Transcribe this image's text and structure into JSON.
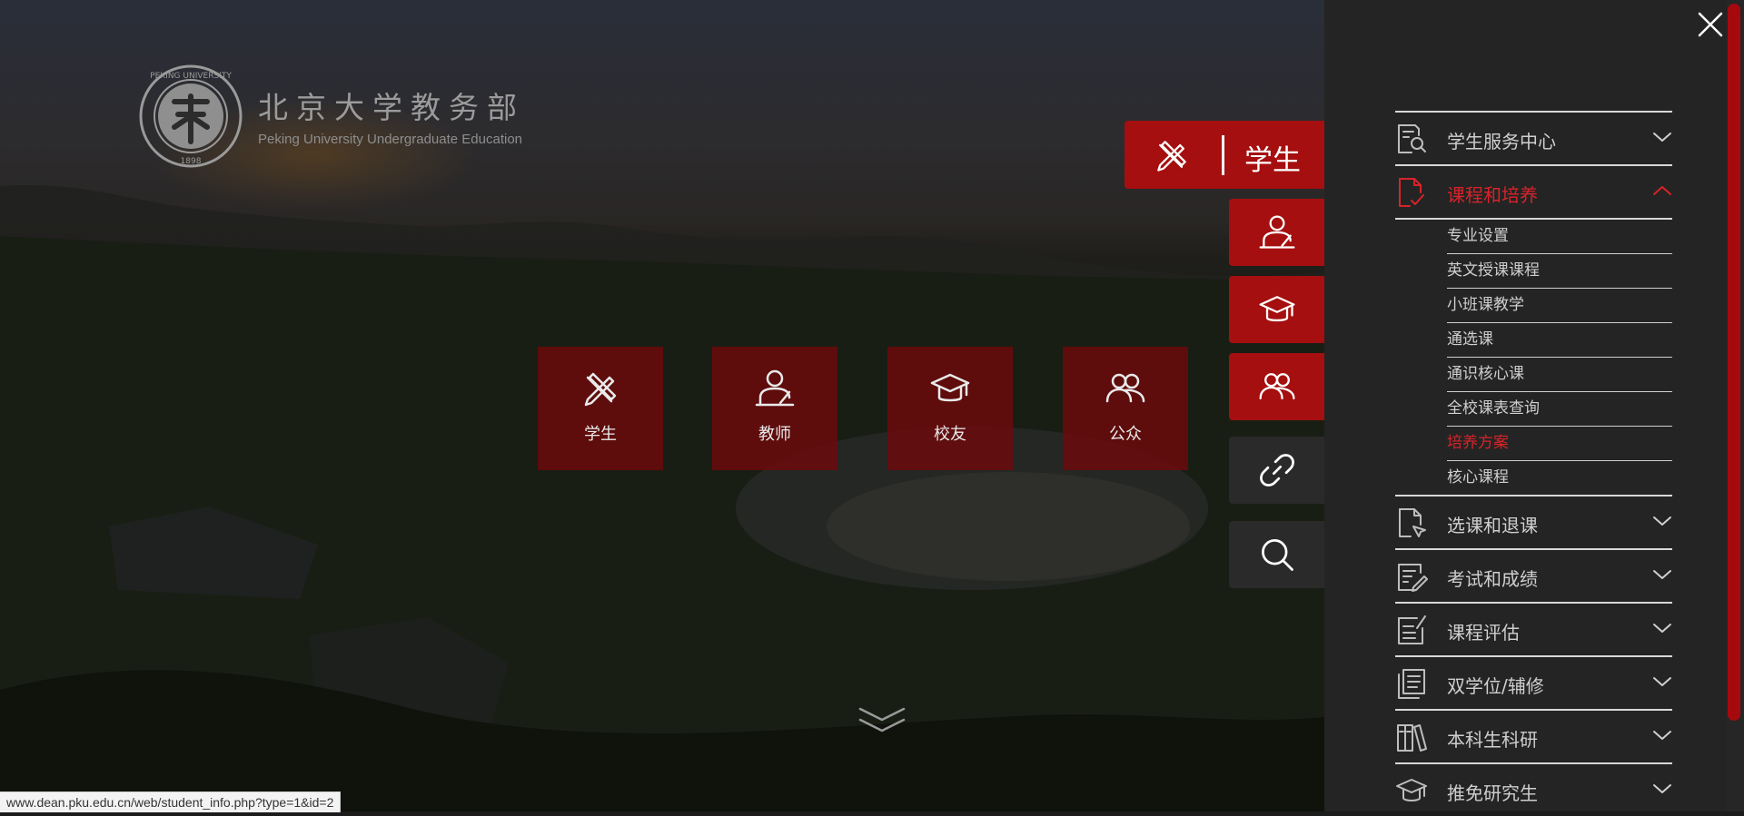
{
  "logo": {
    "title": "北京大学教务部",
    "subtitle": "Peking University Undergraduate Education",
    "seal_ring_text": "PEKING UNIVERSITY",
    "seal_year": "1898"
  },
  "center_tiles": [
    {
      "label": "学生",
      "icon": "pencil-ruler-icon"
    },
    {
      "label": "教师",
      "icon": "teacher-icon"
    },
    {
      "label": "校友",
      "icon": "graduation-cap-icon"
    },
    {
      "label": "公众",
      "icon": "people-icon"
    }
  ],
  "side_nav": {
    "active_label": "学生",
    "buttons": [
      "teacher-icon",
      "graduation-cap-icon",
      "people-icon",
      "link-icon",
      "search-icon"
    ]
  },
  "status_url": "www.dean.pku.edu.cn/web/student_info.php?type=1&id=2",
  "colors": {
    "accent": "#a50f0f",
    "active_text": "#d8232a",
    "panel_bg": "#242424"
  },
  "menu": {
    "items": [
      {
        "label": "学生服务中心",
        "icon": "search-document-icon",
        "expanded": false
      },
      {
        "label": "课程和培养",
        "icon": "document-check-icon",
        "expanded": true,
        "sub": [
          "专业设置",
          "英文授课课程",
          "小班课教学",
          "通选课",
          "通识核心课",
          "全校课表查询",
          "培养方案",
          "核心课程"
        ],
        "active_sub": "培养方案"
      },
      {
        "label": "选课和退课",
        "icon": "document-select-icon",
        "expanded": false
      },
      {
        "label": "考试和成绩",
        "icon": "exam-edit-icon",
        "expanded": false
      },
      {
        "label": "课程评估",
        "icon": "evaluation-icon",
        "expanded": false
      },
      {
        "label": "双学位/辅修",
        "icon": "double-document-icon",
        "expanded": false
      },
      {
        "label": "本科生科研",
        "icon": "books-icon",
        "expanded": false
      },
      {
        "label": "推免研究生",
        "icon": "graduation-cap-icon",
        "expanded": false
      }
    ]
  }
}
